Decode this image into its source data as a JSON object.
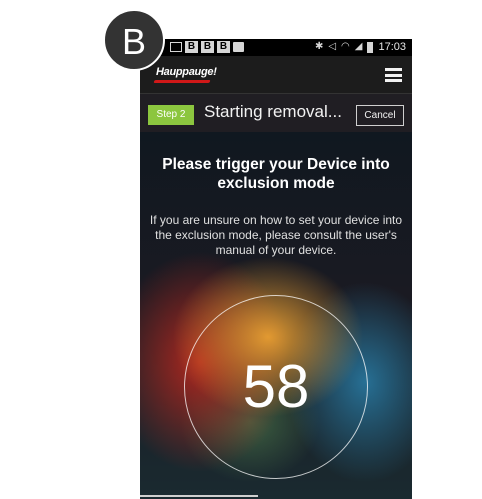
{
  "figure_label": "B",
  "statusbar": {
    "time": "17:03",
    "left_icons": [
      "envelope-icon",
      "b-notification-icon",
      "b-notification-icon",
      "b-notification-icon",
      "bag-icon"
    ],
    "b_letter": "B",
    "right_icons": [
      "bluetooth-icon",
      "mute-icon",
      "wifi-icon",
      "signal-icon",
      "battery-icon"
    ]
  },
  "appbar": {
    "logo": "Hauppauge!"
  },
  "stepbar": {
    "step_label": "Step 2",
    "title": "Starting removal...",
    "cancel_label": "Cancel"
  },
  "content": {
    "headline": "Please trigger your Device into exclusion mode",
    "subtext": "If you are unsure on how to set your device into the exclusion mode, please consult the user's manual of your device.",
    "countdown": "58"
  },
  "colors": {
    "step_badge": "#8cc63f",
    "logo_swoosh": "#d01818"
  }
}
